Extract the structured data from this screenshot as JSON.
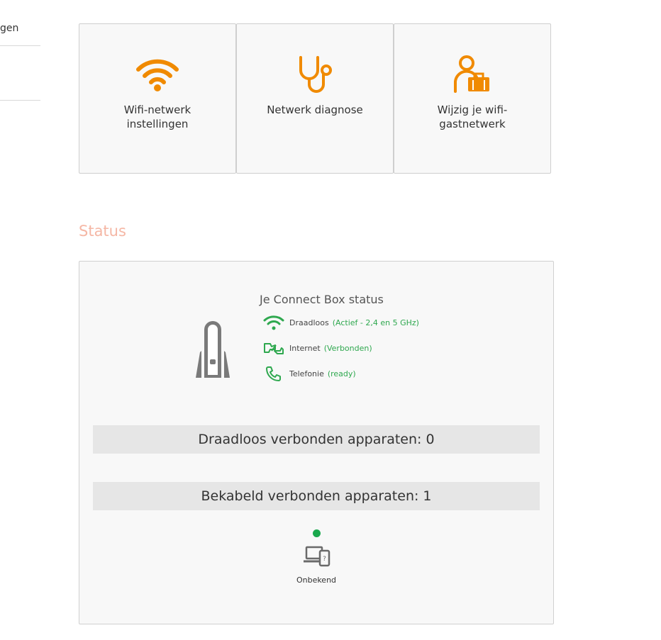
{
  "sidebar": {
    "items": [
      {
        "label": "gen"
      },
      {
        "label": ""
      }
    ]
  },
  "tiles": [
    {
      "label": "Wifi-netwerk instellingen",
      "icon": "wifi-icon"
    },
    {
      "label": "Netwerk diagnose",
      "icon": "stethoscope-icon"
    },
    {
      "label": "Wijzig je wifi-gastnetwerk",
      "icon": "guest-user-icon"
    }
  ],
  "status": {
    "heading": "Status",
    "box_title": "Je Connect Box status",
    "rows": [
      {
        "label": "Draadloos",
        "value": "(Actief - 2,4 en 5 GHz)",
        "icon": "wifi-icon"
      },
      {
        "label": "Internet",
        "value": "(Verbonden)",
        "icon": "internet-icon"
      },
      {
        "label": "Telefonie",
        "value": "(ready)",
        "icon": "phone-icon"
      }
    ],
    "wireless_devices": "Draadloos verbonden apparaten: 0",
    "wired_devices": "Bekabeld verbonden apparaten: 1",
    "clients": [
      {
        "name": "Onbekend",
        "icon": "laptop-phone-icon"
      }
    ]
  },
  "colors": {
    "accent": "#f08a00",
    "status_heading": "#f5b7a5",
    "ok_green": "#2fa84f"
  }
}
